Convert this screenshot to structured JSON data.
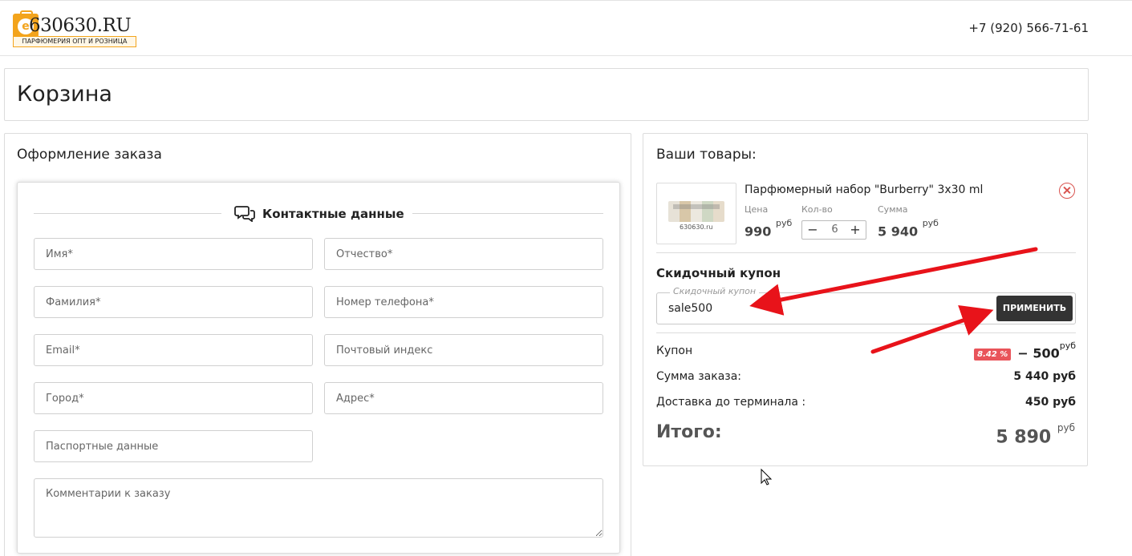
{
  "header": {
    "logo_text": "630630.RU",
    "logo_subtitle": "ПАРФЮМЕРИЯ ОПТ И РОЗНИЦА",
    "phone": "+7 (920) 566-71-61"
  },
  "page_title": "Корзина",
  "order": {
    "title": "Оформление заказа",
    "contact_title": "Контактные данные",
    "fields": {
      "first_name": "Имя*",
      "patronymic": "Отчество*",
      "last_name": "Фамилия*",
      "phone": "Номер телефона*",
      "email": "Email*",
      "postcode": "Почтовый индекс",
      "city": "Город*",
      "address": "Адрес*",
      "passport": "Паспортные данные",
      "comment": "Комментарии к заказу"
    }
  },
  "cart": {
    "title": "Ваши товары:",
    "item": {
      "name": "Парфюмерный набор \"Burberry\" 3x30 ml",
      "thumb_caption": "630630.ru",
      "price_label": "Цена",
      "price": "990",
      "qty_label": "Кол-во",
      "qty": "6",
      "sum_label": "Сумма",
      "sum": "5 940",
      "currency": "руб"
    },
    "coupon": {
      "heading": "Скидочный купон",
      "legend": "Скидочный купон",
      "value": "sale500",
      "apply_label": "ПРИМЕНИТЬ",
      "row_label": "Купон",
      "badge": "8.42 %",
      "discount": "− 500",
      "currency": "руб"
    },
    "summary": {
      "order_sum_label": "Сумма заказа:",
      "order_sum": "5 440 руб",
      "delivery_label": "Доставка до терминала :",
      "delivery": "450 руб",
      "total_label": "Итого:",
      "total": "5 890",
      "currency": "руб"
    }
  },
  "colors": {
    "accent": "#f3a41c",
    "button": "#333333",
    "remove": "#d9534f",
    "badge": "#e9545a",
    "annotation_arrow": "#e8131a"
  }
}
